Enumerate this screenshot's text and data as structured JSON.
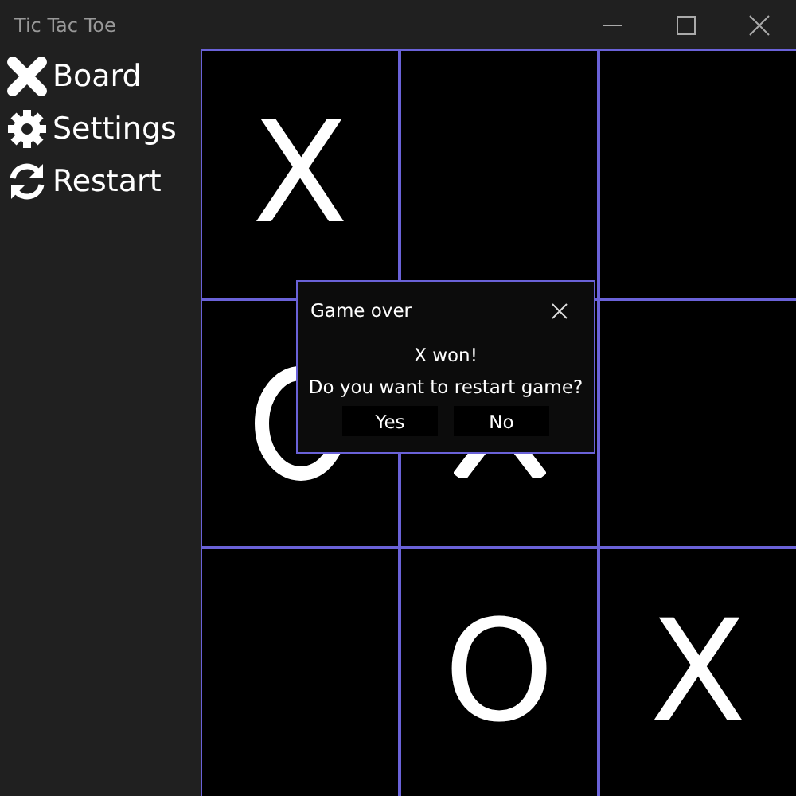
{
  "window": {
    "title": "Tic Tac Toe"
  },
  "sidebar": {
    "items": [
      {
        "label": "Board"
      },
      {
        "label": "Settings"
      },
      {
        "label": "Restart"
      }
    ]
  },
  "board": {
    "cells": [
      {
        "mark": "X"
      },
      {},
      {},
      {
        "kind": "covered-o"
      },
      {
        "kind": "covered-x"
      },
      {},
      {},
      {
        "mark": "O"
      },
      {
        "mark": "X"
      }
    ]
  },
  "dialog": {
    "title": "Game over",
    "message": "X won!",
    "question": "Do you want to restart game?",
    "buttons": [
      "Yes",
      "No"
    ]
  }
}
